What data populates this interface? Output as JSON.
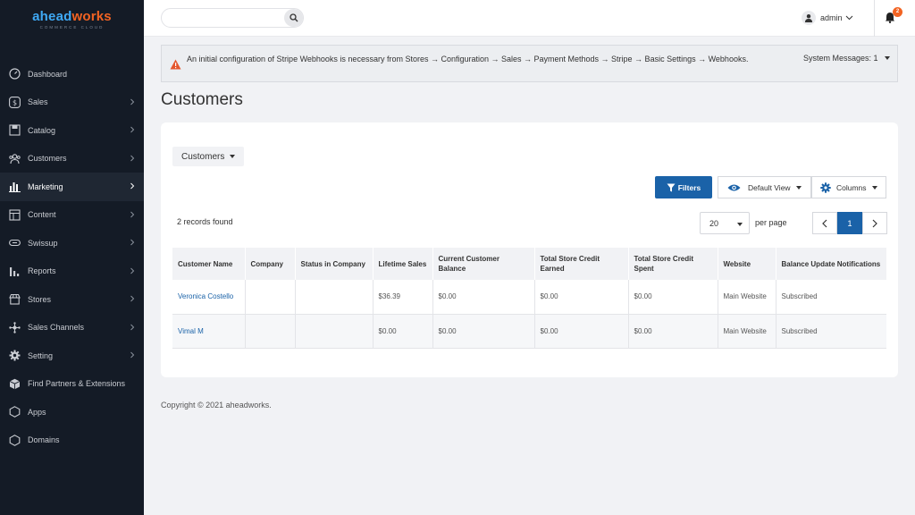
{
  "brand": {
    "name_part1": "ahead",
    "name_part2": "works",
    "tagline": "COMMERCE CLOUD"
  },
  "sidebar": {
    "items": [
      {
        "label": "Dashboard",
        "icon": "dashboard-icon",
        "chevron": false
      },
      {
        "label": "Sales",
        "icon": "dollar-icon",
        "chevron": true
      },
      {
        "label": "Catalog",
        "icon": "catalog-icon",
        "chevron": true
      },
      {
        "label": "Customers",
        "icon": "users-icon",
        "chevron": true
      },
      {
        "label": "Marketing",
        "icon": "bar-chart-icon",
        "chevron": true,
        "active": true
      },
      {
        "label": "Content",
        "icon": "content-icon",
        "chevron": true
      },
      {
        "label": "Swissup",
        "icon": "swissup-icon",
        "chevron": true
      },
      {
        "label": "Reports",
        "icon": "reports-icon",
        "chevron": true
      },
      {
        "label": "Stores",
        "icon": "store-icon",
        "chevron": true
      },
      {
        "label": "Sales Channels",
        "icon": "channels-icon",
        "chevron": true
      },
      {
        "label": "Setting",
        "icon": "gear-icon",
        "chevron": true
      },
      {
        "label": "Find Partners & Extensions",
        "icon": "box-icon",
        "chevron": false
      },
      {
        "label": "Apps",
        "icon": "hexagon-icon",
        "chevron": false
      },
      {
        "label": "Domains",
        "icon": "hexagon-icon",
        "chevron": false
      }
    ]
  },
  "header": {
    "search_placeholder": "",
    "user_name": "admin",
    "notification_count": "2"
  },
  "message": {
    "text": "An initial configuration of Stripe Webhooks is necessary from Stores → Configuration → Sales → Payment Methods → Stripe → Basic Settings → Webhooks.",
    "system_messages": "System Messages: 1"
  },
  "page": {
    "title": "Customers"
  },
  "grid": {
    "switcher_label": "Customers",
    "filters_label": "Filters",
    "view_label": "Default View",
    "columns_label": "Columns",
    "records_found": "2 records found",
    "per_page_value": "20",
    "per_page_label": "per page",
    "current_page": "1",
    "headers": [
      "Customer Name",
      "Company",
      "Status in Company",
      "Lifetime Sales",
      "Current Customer Balance",
      "Total Store Credit Earned",
      "Total Store Credit Spent",
      "Website",
      "Balance Update Notifications"
    ],
    "rows": [
      [
        "Veronica Costello",
        "",
        "",
        "$36.39",
        "$0.00",
        "$0.00",
        "$0.00",
        "Main Website",
        "Subscribed"
      ],
      [
        "Vimal M",
        "",
        "",
        "$0.00",
        "$0.00",
        "$0.00",
        "$0.00",
        "Main Website",
        "Subscribed"
      ]
    ]
  },
  "footer": {
    "copyright": "Copyright © 2021 aheadworks."
  },
  "colors": {
    "sidebar_bg": "#141b26",
    "accent_blue": "#1a62a8",
    "brand_orange": "#f26322"
  }
}
